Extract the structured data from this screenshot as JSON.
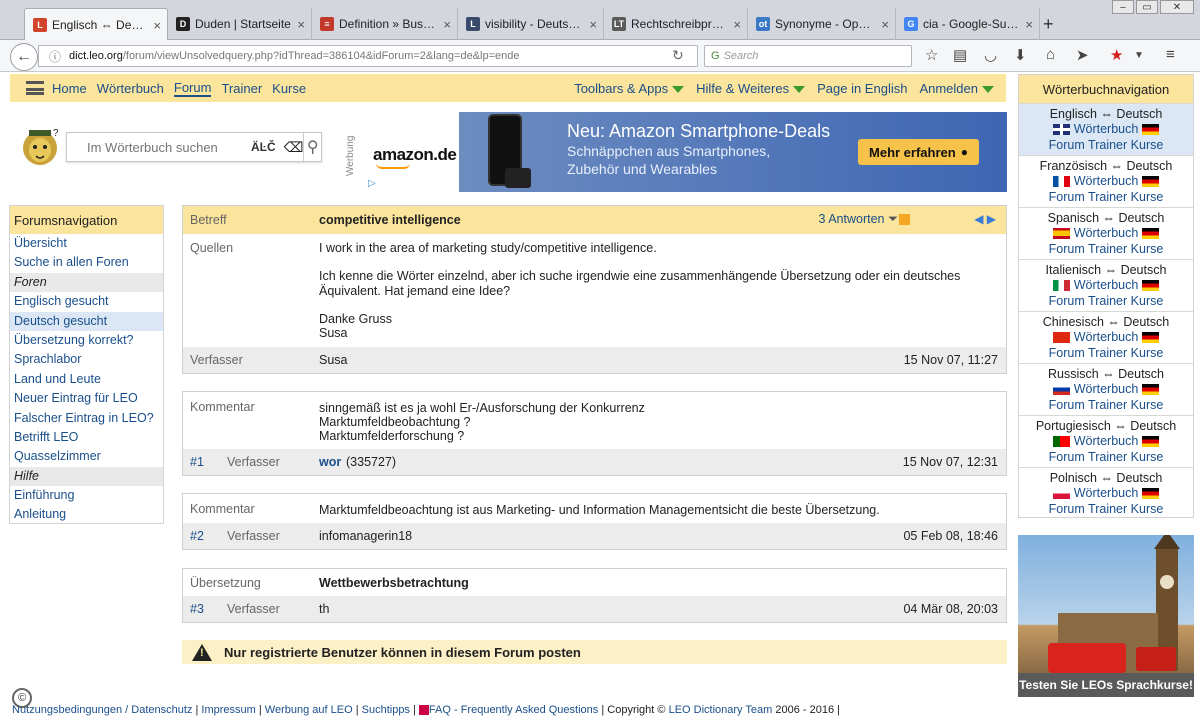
{
  "browser": {
    "tabs": [
      {
        "title": "Englisch ⇔ Deutsc...",
        "fav": "L",
        "favcolor": "#d1432b",
        "active": true
      },
      {
        "title": "Duden | Startseite",
        "fav": "D",
        "favcolor": "#222222"
      },
      {
        "title": "Definition » Busin...",
        "fav": "≡",
        "favcolor": "#c0392b"
      },
      {
        "title": "visibility - Deutsch...",
        "fav": "L",
        "favcolor": "#3a4a6b"
      },
      {
        "title": "Rechtschreibprüfu...",
        "fav": "LT",
        "favcolor": "#5b5b5b"
      },
      {
        "title": "Synonyme - Open...",
        "fav": "ot",
        "favcolor": "#3a79c6"
      },
      {
        "title": "cia - Google-Suche",
        "fav": "G",
        "favcolor": "#4285f4"
      }
    ],
    "new_tab": "+",
    "url_domain": "dict.leo.org",
    "url_path": "/forum/viewUnsolvedquery.php?idThread=386104&idForum=2&lang=de&lp=ende",
    "search_placeholder": "Search"
  },
  "leonav": {
    "items": [
      "Home",
      "Wörterbuch",
      "Forum",
      "Trainer",
      "Kurse"
    ],
    "right": [
      "Toolbars & Apps",
      "Hilfe & Weiteres",
      "Page in English",
      "Anmelden"
    ]
  },
  "search": {
    "placeholder": "Im Wörterbuch suchen",
    "special_chars": "ÄĿČ"
  },
  "ad": {
    "werbung": "Werbung",
    "brand": "amazon.de",
    "headline": "Neu: Amazon Smartphone-Deals",
    "sub1": "Schnäppchen aus Smartphones,",
    "sub2": "Zubehör und Wearables",
    "button": "Mehr erfahren"
  },
  "forumnav": {
    "title": "Forumsnavigation",
    "items": [
      {
        "label": "Übersicht",
        "type": "link"
      },
      {
        "label": "Suche in allen Foren",
        "type": "link"
      },
      {
        "label": "Foren",
        "type": "group"
      },
      {
        "label": "Englisch gesucht",
        "type": "link"
      },
      {
        "label": "Deutsch gesucht",
        "type": "link",
        "selected": true
      },
      {
        "label": "Übersetzung korrekt?",
        "type": "link"
      },
      {
        "label": "Sprachlabor",
        "type": "link"
      },
      {
        "label": "Land und Leute",
        "type": "link"
      },
      {
        "label": "Neuer Eintrag für LEO",
        "type": "link"
      },
      {
        "label": "Falscher Eintrag in LEO?",
        "type": "link"
      },
      {
        "label": "Betrifft LEO",
        "type": "link"
      },
      {
        "label": "Quasselzimmer",
        "type": "link"
      },
      {
        "label": "Hilfe",
        "type": "group"
      },
      {
        "label": "Einführung",
        "type": "link"
      },
      {
        "label": "Anleitung",
        "type": "link"
      }
    ]
  },
  "thread": {
    "subject_label": "Betreff",
    "subject": "competitive intelligence",
    "answers": "3 Antworten",
    "sources_label": "Quellen",
    "body": [
      "I work in the area of marketing study/competitive intelligence.",
      "Ich kenne die Wörter einzelnd, aber ich suche irgendwie eine zusammenhängende Übersetzung oder ein deutsches",
      "Äquivalent. Hat jemand eine Idee?",
      "Danke Gruss",
      "Susa"
    ],
    "author_label": "Verfasser",
    "author": "Susa",
    "date": "15 Nov 07, 11:27",
    "replies": [
      {
        "label": "Kommentar",
        "lines": [
          "sinngemäß ist es ja wohl Er-/Ausforschung der Konkurrenz",
          "Marktumfeldbeobachtung ?",
          "Marktumfelderforschung ?"
        ],
        "num": "#1",
        "author_label": "Verfasser",
        "author": "wor",
        "author_extra": "(335727)",
        "date": "15 Nov 07, 12:31"
      },
      {
        "label": "Kommentar",
        "lines": [
          "Marktumfeldbeoachtung ist aus Marketing- und Information Managementsicht die beste Übersetzung."
        ],
        "num": "#2",
        "author_label": "Verfasser",
        "author": "infomanagerin18",
        "date": "05 Feb 08, 18:46"
      },
      {
        "label": "Übersetzung",
        "lines": [
          "Wettbewerbsbetrachtung"
        ],
        "num": "#3",
        "author_label": "Verfasser",
        "author": "th",
        "date": "04 Mär 08, 20:03"
      }
    ],
    "warning": "Nur registrierte Benutzer können in diesem Forum posten"
  },
  "dictnav": {
    "title": "Wörterbuchnavigation",
    "langs": [
      {
        "name": "Englisch ⇔ Deutsch",
        "flag": "uk",
        "selected": true
      },
      {
        "name": "Französisch ⇔ Deutsch",
        "flag": "fr"
      },
      {
        "name": "Spanisch ⇔ Deutsch",
        "flag": "es"
      },
      {
        "name": "Italienisch ⇔ Deutsch",
        "flag": "it"
      },
      {
        "name": "Chinesisch ⇔ Deutsch",
        "flag": "cn"
      },
      {
        "name": "Russisch ⇔ Deutsch",
        "flag": "ru"
      },
      {
        "name": "Portugiesisch ⇔ Deutsch",
        "flag": "pt"
      },
      {
        "name": "Polnisch ⇔ Deutsch",
        "flag": "pl"
      }
    ],
    "woerterbuch": "Wörterbuch",
    "forum": "Forum",
    "trainer": "Trainer",
    "kurse": "Kurse"
  },
  "promo": {
    "caption": "Testen Sie LEOs Sprachkurse!"
  },
  "footer": {
    "links": [
      "Nutzungsbedingungen / Datenschutz",
      "Impressum",
      "Werbung auf LEO",
      "Suchtipps",
      "FAQ - Frequently Asked Questions"
    ],
    "copyright_prefix": "Copyright ©",
    "copyright_link": "LEO Dictionary Team",
    "years": "2006 - 2016"
  }
}
